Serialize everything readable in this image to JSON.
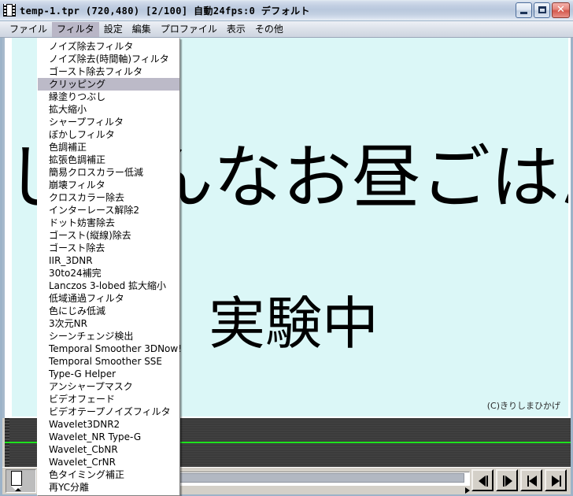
{
  "window": {
    "title": "temp-1.tpr (720,480)  [2/100]  自動24fps:0  デフォルト",
    "icon": "film-strip-icon",
    "minimize_label": "",
    "maximize_label": "",
    "close_label": "✕"
  },
  "menubar": {
    "items": [
      {
        "label": "ファイル",
        "active": false
      },
      {
        "label": "フィルタ",
        "active": true
      },
      {
        "label": "設定",
        "active": false
      },
      {
        "label": "編集",
        "active": false
      },
      {
        "label": "プロファイル",
        "active": false
      },
      {
        "label": "表示",
        "active": false
      },
      {
        "label": "その他",
        "active": false
      }
    ]
  },
  "filter_menu": {
    "selected": "クリッピング",
    "items": [
      "ノイズ除去フィルタ",
      "ノイズ除去(時間軸)フィルタ",
      "ゴースト除去フィルタ",
      "クリッピング",
      "縁塗りつぶし",
      "拡大縮小",
      "シャープフィルタ",
      "ぼかしフィルタ",
      "色調補正",
      "拡張色調補正",
      "簡易クロスカラー低減",
      "崩壊フィルタ",
      "クロスカラー除去",
      "インターレース解除2",
      "ドット妨害除去",
      "ゴースト(縦線)除去",
      "ゴースト除去",
      "IIR_3DNR",
      "30to24補完",
      "Lanczos 3-lobed 拡大縮小",
      "低域通過フィルタ",
      "色にじみ低減",
      "3次元NR",
      "シーンチェンジ検出",
      "Temporal Smoother 3DNow!",
      "Temporal Smoother SSE",
      "Type-G Helper",
      "アンシャープマスク",
      "ビデオフェード",
      "ビデオテープノイズフィルタ",
      "Wavelet3DNR2",
      "Wavelet_NR Type-G",
      "Wavelet_CbNR",
      "Wavelet_CrNR",
      "色タイミング補正",
      "再YC分離"
    ]
  },
  "video": {
    "background_color": "#dbf7f7",
    "line1": "しいんなお昼ごはん",
    "line2": "実験中",
    "credit": "(C)きりしまひかげ"
  },
  "timeline": {
    "background_color": "#3b3b3b",
    "marker_color": "#1ee11e"
  },
  "transport": {
    "buttons": [
      {
        "name": "prev-frame-button",
        "glyph": "prev-frame"
      },
      {
        "name": "next-frame-button",
        "glyph": "next-frame"
      },
      {
        "name": "jump-start-button",
        "glyph": "jump-start"
      },
      {
        "name": "jump-end-button",
        "glyph": "jump-end"
      }
    ]
  }
}
